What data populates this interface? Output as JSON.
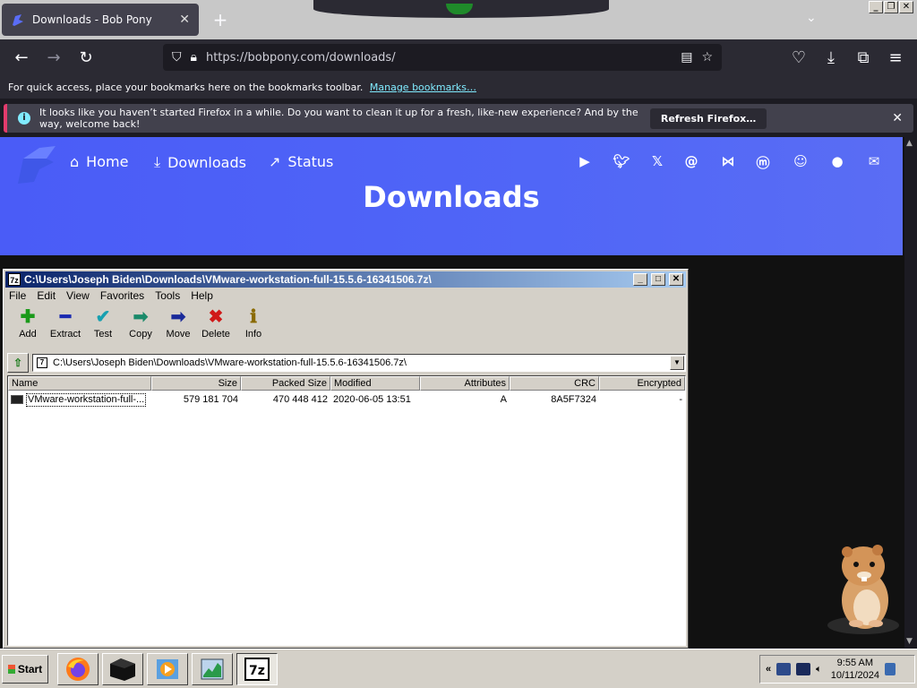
{
  "browser": {
    "tab_title": "Downloads - Bob Pony",
    "tab_close": "✕",
    "new_tab": "+",
    "url": "https://bobpony.com/downloads/",
    "bookmarks_msg": "For quick access, place your bookmarks here on the bookmarks toolbar.",
    "bookmarks_link": "Manage bookmarks…",
    "notification": "It looks like you haven’t started Firefox in a while. Do you want to clean it up for a fresh, like-new experience? And by the way, welcome back!",
    "refresh_button": "Refresh Firefox…"
  },
  "site": {
    "nav": [
      "Home",
      "Downloads",
      "Status"
    ],
    "heading": "Downloads",
    "social_icons": [
      "youtube-icon",
      "twitter-icon",
      "x-icon",
      "threads-icon",
      "bluesky-icon",
      "mastodon-icon",
      "discord-icon",
      "github-icon",
      "email-icon"
    ],
    "colors": {
      "hero_start": "#4a5cf7",
      "hero_end": "#5a6df4"
    }
  },
  "zip": {
    "title": "C:\\Users\\Joseph Biden\\Downloads\\VMware-workstation-full-15.5.6-16341506.7z\\",
    "app_icon": "7z",
    "menu": [
      "File",
      "Edit",
      "View",
      "Favorites",
      "Tools",
      "Help"
    ],
    "tools": [
      {
        "label": "Add",
        "glyph": "✚",
        "color": "#1a9a1a"
      },
      {
        "label": "Extract",
        "glyph": "━",
        "color": "#1a2ab0"
      },
      {
        "label": "Test",
        "glyph": "✔",
        "color": "#18a0b0"
      },
      {
        "label": "Copy",
        "glyph": "➡",
        "color": "#1a8a6a"
      },
      {
        "label": "Move",
        "glyph": "➡",
        "color": "#1a2a9a"
      },
      {
        "label": "Delete",
        "glyph": "✖",
        "color": "#d01818"
      },
      {
        "label": "Info",
        "glyph": "ℹ",
        "color": "#8a6a00"
      }
    ],
    "address": "C:\\Users\\Joseph Biden\\Downloads\\VMware-workstation-full-15.5.6-16341506.7z\\",
    "columns": [
      "Name",
      "Size",
      "Packed Size",
      "Modified",
      "Attributes",
      "CRC",
      "Encrypted"
    ],
    "rows": [
      {
        "name": "VMware-workstation-full-...",
        "size": "579 181 704",
        "packed": "470 448 412",
        "modified": "2020-06-05 13:51",
        "attributes": "A",
        "crc": "8A5F7324",
        "encrypted": "-"
      }
    ]
  },
  "taskbar": {
    "start": "Start",
    "time": "9:55 AM",
    "date": "10/11/2024",
    "tray_expand": "«"
  }
}
